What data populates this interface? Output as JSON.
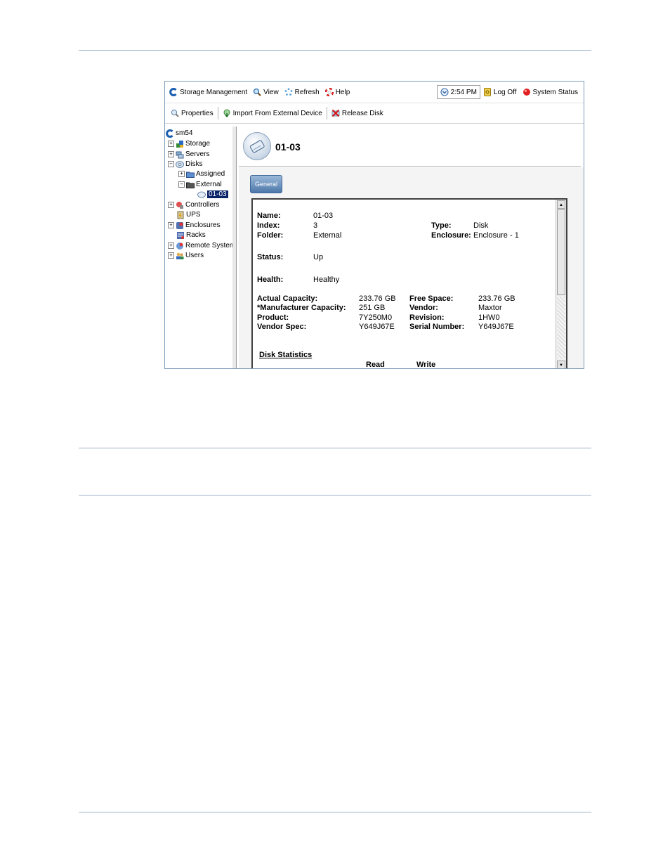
{
  "toolbar_top": {
    "storage_management": "Storage Management",
    "view": "View",
    "refresh": "Refresh",
    "help": "Help",
    "clock": "2:54 PM",
    "log_off": "Log Off",
    "system_status": "System Status"
  },
  "toolbar_actions": {
    "properties": "Properties",
    "import": "Import From External Device",
    "release": "Release Disk"
  },
  "tree": {
    "root": "sm54",
    "storage": "Storage",
    "servers": "Servers",
    "disks": "Disks",
    "assigned": "Assigned",
    "external": "External",
    "selected": "01-03",
    "controllers": "Controllers",
    "ups": "UPS",
    "enclosures": "Enclosures",
    "racks": "Racks",
    "remote_systems": "Remote Systems",
    "users": "Users"
  },
  "header": {
    "title": "01-03"
  },
  "tab": {
    "general": "General"
  },
  "details": {
    "name_label": "Name:",
    "name": "01-03",
    "index_label": "Index:",
    "index": "3",
    "folder_label": "Folder:",
    "folder": "External",
    "type_label": "Type:",
    "type": "Disk",
    "enclosure_label": "Enclosure:",
    "enclosure": "Enclosure - 1",
    "status_label": "Status:",
    "status": "Up",
    "health_label": "Health:",
    "health": "Healthy",
    "actual_capacity_label": "Actual Capacity:",
    "actual_capacity": "233.76 GB",
    "mfr_capacity_label": "*Manufacturer Capacity:",
    "mfr_capacity": "251 GB",
    "product_label": "Product:",
    "product": "7Y250M0",
    "vendor_spec_label": "Vendor Spec:",
    "vendor_spec": "Y649J67E",
    "free_space_label": "Free Space:",
    "free_space": "233.76 GB",
    "vendor_label": "Vendor:",
    "vendor": "Maxtor",
    "revision_label": "Revision:",
    "revision": "1HW0",
    "serial_label": "Serial Number:",
    "serial": "Y649J67E"
  },
  "stats": {
    "title": "Disk Statistics",
    "read": "Read",
    "write": "Write"
  }
}
